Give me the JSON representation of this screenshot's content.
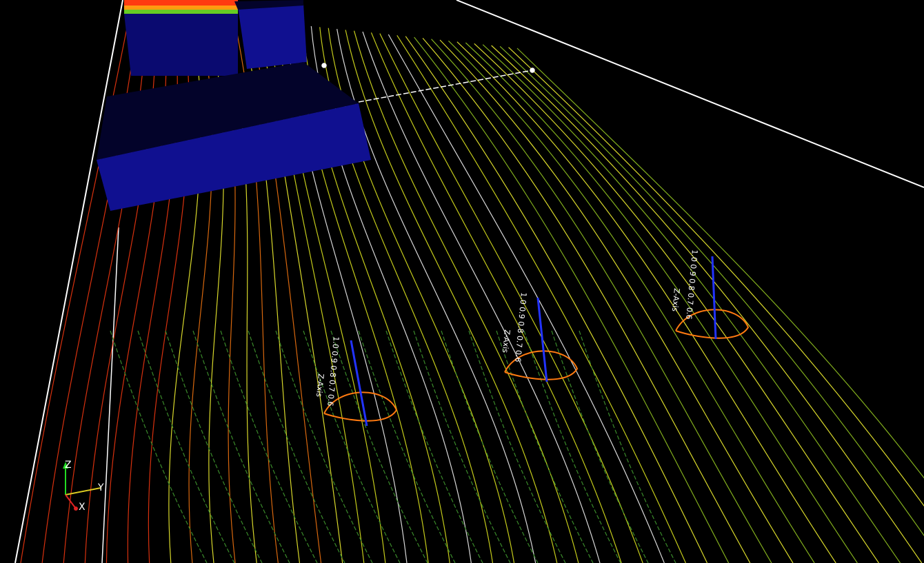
{
  "viewport": {
    "background": "#000000",
    "streamline_colors": [
      "#ffff33",
      "#e8f020",
      "#99cc22",
      "#3a8a2a",
      "#ff3a10",
      "#ff7a10",
      "#ffffff"
    ],
    "building_color": "#0e0e8a",
    "building_top_color": "#03032a",
    "probe_line_color": "#2233ff"
  },
  "probes": [
    {
      "axis_label": "Z-Axis",
      "tick_values": "1.0 0.9 0.8 0.7 0.6"
    },
    {
      "axis_label": "Z-Axis",
      "tick_values": "1.0 0.9 0.8 0.7 0.6"
    },
    {
      "axis_label": "Z-Axis",
      "tick_values": "1.0 0.9 0.8 0.7 0.6"
    }
  ],
  "orientation_axes": {
    "z_label": "Z",
    "y_label": "Y",
    "x_label": "X",
    "z_color": "#22dd22",
    "y_color": "#ddcc22",
    "x_color": "#dd2222"
  }
}
